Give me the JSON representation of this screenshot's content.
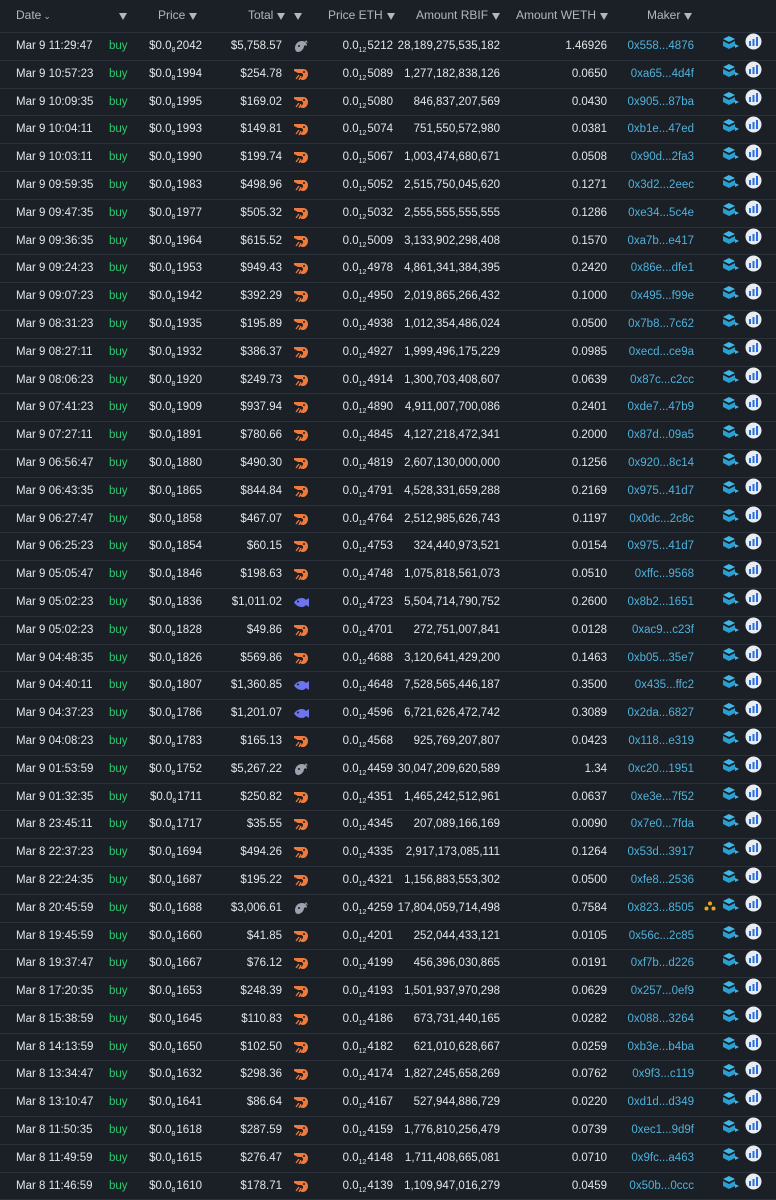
{
  "headers": {
    "date": "Date",
    "price": "Price",
    "total": "Total",
    "price_eth": "Price ETH",
    "amount_rbif": "Amount RBIF",
    "amount_weth": "Amount WETH",
    "maker": "Maker"
  },
  "colors": {
    "buy": "#2ec970",
    "maker": "#4fb2dc",
    "shrimp": "#f07a3c",
    "whale": "#9aa3ae",
    "fish": "#6c74ee"
  },
  "trades": [
    {
      "date": "Mar 9 11:29:47",
      "type": "buy",
      "price_pre": "$0.0",
      "price_sub": "8",
      "price_post": "2042",
      "total": "$5,758.57",
      "trader": "whale",
      "peth_pre": "0.0",
      "peth_sub": "12",
      "peth_post": "5212",
      "amount": "28,189,275,535,182",
      "weth": "1.46926",
      "maker": "0x558...4876"
    },
    {
      "date": "Mar 9 10:57:23",
      "type": "buy",
      "price_pre": "$0.0",
      "price_sub": "8",
      "price_post": "1994",
      "total": "$254.78",
      "trader": "shrimp",
      "peth_pre": "0.0",
      "peth_sub": "12",
      "peth_post": "5089",
      "amount": "1,277,182,838,126",
      "weth": "0.0650",
      "maker": "0xa65...4d4f"
    },
    {
      "date": "Mar 9 10:09:35",
      "type": "buy",
      "price_pre": "$0.0",
      "price_sub": "8",
      "price_post": "1995",
      "total": "$169.02",
      "trader": "shrimp",
      "peth_pre": "0.0",
      "peth_sub": "12",
      "peth_post": "5080",
      "amount": "846,837,207,569",
      "weth": "0.0430",
      "maker": "0x905...87ba"
    },
    {
      "date": "Mar 9 10:04:11",
      "type": "buy",
      "price_pre": "$0.0",
      "price_sub": "8",
      "price_post": "1993",
      "total": "$149.81",
      "trader": "shrimp",
      "peth_pre": "0.0",
      "peth_sub": "12",
      "peth_post": "5074",
      "amount": "751,550,572,980",
      "weth": "0.0381",
      "maker": "0xb1e...47ed"
    },
    {
      "date": "Mar 9 10:03:11",
      "type": "buy",
      "price_pre": "$0.0",
      "price_sub": "8",
      "price_post": "1990",
      "total": "$199.74",
      "trader": "shrimp",
      "peth_pre": "0.0",
      "peth_sub": "12",
      "peth_post": "5067",
      "amount": "1,003,474,680,671",
      "weth": "0.0508",
      "maker": "0x90d...2fa3"
    },
    {
      "date": "Mar 9 09:59:35",
      "type": "buy",
      "price_pre": "$0.0",
      "price_sub": "8",
      "price_post": "1983",
      "total": "$498.96",
      "trader": "shrimp",
      "peth_pre": "0.0",
      "peth_sub": "12",
      "peth_post": "5052",
      "amount": "2,515,750,045,620",
      "weth": "0.1271",
      "maker": "0x3d2...2eec"
    },
    {
      "date": "Mar 9 09:47:35",
      "type": "buy",
      "price_pre": "$0.0",
      "price_sub": "8",
      "price_post": "1977",
      "total": "$505.32",
      "trader": "shrimp",
      "peth_pre": "0.0",
      "peth_sub": "12",
      "peth_post": "5032",
      "amount": "2,555,555,555,555",
      "weth": "0.1286",
      "maker": "0xe34...5c4e"
    },
    {
      "date": "Mar 9 09:36:35",
      "type": "buy",
      "price_pre": "$0.0",
      "price_sub": "8",
      "price_post": "1964",
      "total": "$615.52",
      "trader": "shrimp",
      "peth_pre": "0.0",
      "peth_sub": "12",
      "peth_post": "5009",
      "amount": "3,133,902,298,408",
      "weth": "0.1570",
      "maker": "0xa7b...e417"
    },
    {
      "date": "Mar 9 09:24:23",
      "type": "buy",
      "price_pre": "$0.0",
      "price_sub": "8",
      "price_post": "1953",
      "total": "$949.43",
      "trader": "shrimp",
      "peth_pre": "0.0",
      "peth_sub": "12",
      "peth_post": "4978",
      "amount": "4,861,341,384,395",
      "weth": "0.2420",
      "maker": "0x86e...dfe1"
    },
    {
      "date": "Mar 9 09:07:23",
      "type": "buy",
      "price_pre": "$0.0",
      "price_sub": "8",
      "price_post": "1942",
      "total": "$392.29",
      "trader": "shrimp",
      "peth_pre": "0.0",
      "peth_sub": "12",
      "peth_post": "4950",
      "amount": "2,019,865,266,432",
      "weth": "0.1000",
      "maker": "0x495...f99e"
    },
    {
      "date": "Mar 9 08:31:23",
      "type": "buy",
      "price_pre": "$0.0",
      "price_sub": "8",
      "price_post": "1935",
      "total": "$195.89",
      "trader": "shrimp",
      "peth_pre": "0.0",
      "peth_sub": "12",
      "peth_post": "4938",
      "amount": "1,012,354,486,024",
      "weth": "0.0500",
      "maker": "0x7b8...7c62"
    },
    {
      "date": "Mar 9 08:27:11",
      "type": "buy",
      "price_pre": "$0.0",
      "price_sub": "8",
      "price_post": "1932",
      "total": "$386.37",
      "trader": "shrimp",
      "peth_pre": "0.0",
      "peth_sub": "12",
      "peth_post": "4927",
      "amount": "1,999,496,175,229",
      "weth": "0.0985",
      "maker": "0xecd...ce9a"
    },
    {
      "date": "Mar 9 08:06:23",
      "type": "buy",
      "price_pre": "$0.0",
      "price_sub": "8",
      "price_post": "1920",
      "total": "$249.73",
      "trader": "shrimp",
      "peth_pre": "0.0",
      "peth_sub": "12",
      "peth_post": "4914",
      "amount": "1,300,703,408,607",
      "weth": "0.0639",
      "maker": "0x87c...c2cc"
    },
    {
      "date": "Mar 9 07:41:23",
      "type": "buy",
      "price_pre": "$0.0",
      "price_sub": "8",
      "price_post": "1909",
      "total": "$937.94",
      "trader": "shrimp",
      "peth_pre": "0.0",
      "peth_sub": "12",
      "peth_post": "4890",
      "amount": "4,911,007,700,086",
      "weth": "0.2401",
      "maker": "0xde7...47b9"
    },
    {
      "date": "Mar 9 07:27:11",
      "type": "buy",
      "price_pre": "$0.0",
      "price_sub": "8",
      "price_post": "1891",
      "total": "$780.66",
      "trader": "shrimp",
      "peth_pre": "0.0",
      "peth_sub": "12",
      "peth_post": "4845",
      "amount": "4,127,218,472,341",
      "weth": "0.2000",
      "maker": "0x87d...09a5"
    },
    {
      "date": "Mar 9 06:56:47",
      "type": "buy",
      "price_pre": "$0.0",
      "price_sub": "8",
      "price_post": "1880",
      "total": "$490.30",
      "trader": "shrimp",
      "peth_pre": "0.0",
      "peth_sub": "12",
      "peth_post": "4819",
      "amount": "2,607,130,000,000",
      "weth": "0.1256",
      "maker": "0x920...8c14"
    },
    {
      "date": "Mar 9 06:43:35",
      "type": "buy",
      "price_pre": "$0.0",
      "price_sub": "8",
      "price_post": "1865",
      "total": "$844.84",
      "trader": "shrimp",
      "peth_pre": "0.0",
      "peth_sub": "12",
      "peth_post": "4791",
      "amount": "4,528,331,659,288",
      "weth": "0.2169",
      "maker": "0x975...41d7"
    },
    {
      "date": "Mar 9 06:27:47",
      "type": "buy",
      "price_pre": "$0.0",
      "price_sub": "8",
      "price_post": "1858",
      "total": "$467.07",
      "trader": "shrimp",
      "peth_pre": "0.0",
      "peth_sub": "12",
      "peth_post": "4764",
      "amount": "2,512,985,626,743",
      "weth": "0.1197",
      "maker": "0x0dc...2c8c"
    },
    {
      "date": "Mar 9 06:25:23",
      "type": "buy",
      "price_pre": "$0.0",
      "price_sub": "8",
      "price_post": "1854",
      "total": "$60.15",
      "trader": "shrimp",
      "peth_pre": "0.0",
      "peth_sub": "12",
      "peth_post": "4753",
      "amount": "324,440,973,521",
      "weth": "0.0154",
      "maker": "0x975...41d7"
    },
    {
      "date": "Mar 9 05:05:47",
      "type": "buy",
      "price_pre": "$0.0",
      "price_sub": "8",
      "price_post": "1846",
      "total": "$198.63",
      "trader": "shrimp",
      "peth_pre": "0.0",
      "peth_sub": "12",
      "peth_post": "4748",
      "amount": "1,075,818,561,073",
      "weth": "0.0510",
      "maker": "0xffc...9568"
    },
    {
      "date": "Mar 9 05:02:23",
      "type": "buy",
      "price_pre": "$0.0",
      "price_sub": "8",
      "price_post": "1836",
      "total": "$1,011.02",
      "trader": "fish",
      "peth_pre": "0.0",
      "peth_sub": "12",
      "peth_post": "4723",
      "amount": "5,504,714,790,752",
      "weth": "0.2600",
      "maker": "0x8b2...1651"
    },
    {
      "date": "Mar 9 05:02:23",
      "type": "buy",
      "price_pre": "$0.0",
      "price_sub": "8",
      "price_post": "1828",
      "total": "$49.86",
      "trader": "shrimp",
      "peth_pre": "0.0",
      "peth_sub": "12",
      "peth_post": "4701",
      "amount": "272,751,007,841",
      "weth": "0.0128",
      "maker": "0xac9...c23f"
    },
    {
      "date": "Mar 9 04:48:35",
      "type": "buy",
      "price_pre": "$0.0",
      "price_sub": "8",
      "price_post": "1826",
      "total": "$569.86",
      "trader": "shrimp",
      "peth_pre": "0.0",
      "peth_sub": "12",
      "peth_post": "4688",
      "amount": "3,120,641,429,200",
      "weth": "0.1463",
      "maker": "0xb05...35e7"
    },
    {
      "date": "Mar 9 04:40:11",
      "type": "buy",
      "price_pre": "$0.0",
      "price_sub": "8",
      "price_post": "1807",
      "total": "$1,360.85",
      "trader": "fish",
      "peth_pre": "0.0",
      "peth_sub": "12",
      "peth_post": "4648",
      "amount": "7,528,565,446,187",
      "weth": "0.3500",
      "maker": "0x435...ffc2"
    },
    {
      "date": "Mar 9 04:37:23",
      "type": "buy",
      "price_pre": "$0.0",
      "price_sub": "8",
      "price_post": "1786",
      "total": "$1,201.07",
      "trader": "fish",
      "peth_pre": "0.0",
      "peth_sub": "12",
      "peth_post": "4596",
      "amount": "6,721,626,472,742",
      "weth": "0.3089",
      "maker": "0x2da...6827"
    },
    {
      "date": "Mar 9 04:08:23",
      "type": "buy",
      "price_pre": "$0.0",
      "price_sub": "8",
      "price_post": "1783",
      "total": "$165.13",
      "trader": "shrimp",
      "peth_pre": "0.0",
      "peth_sub": "12",
      "peth_post": "4568",
      "amount": "925,769,207,807",
      "weth": "0.0423",
      "maker": "0x118...e319"
    },
    {
      "date": "Mar 9 01:53:59",
      "type": "buy",
      "price_pre": "$0.0",
      "price_sub": "8",
      "price_post": "1752",
      "total": "$5,267.22",
      "trader": "whale",
      "peth_pre": "0.0",
      "peth_sub": "12",
      "peth_post": "4459",
      "amount": "30,047,209,620,589",
      "weth": "1.34",
      "maker": "0xc20...1951"
    },
    {
      "date": "Mar 9 01:32:35",
      "type": "buy",
      "price_pre": "$0.0",
      "price_sub": "8",
      "price_post": "1711",
      "total": "$250.82",
      "trader": "shrimp",
      "peth_pre": "0.0",
      "peth_sub": "12",
      "peth_post": "4351",
      "amount": "1,465,242,512,961",
      "weth": "0.0637",
      "maker": "0xe3e...7f52"
    },
    {
      "date": "Mar 8 23:45:11",
      "type": "buy",
      "price_pre": "$0.0",
      "price_sub": "8",
      "price_post": "1717",
      "total": "$35.55",
      "trader": "shrimp",
      "peth_pre": "0.0",
      "peth_sub": "12",
      "peth_post": "4345",
      "amount": "207,089,166,169",
      "weth": "0.0090",
      "maker": "0x7e0...7fda"
    },
    {
      "date": "Mar 8 22:37:23",
      "type": "buy",
      "price_pre": "$0.0",
      "price_sub": "8",
      "price_post": "1694",
      "total": "$494.26",
      "trader": "shrimp",
      "peth_pre": "0.0",
      "peth_sub": "12",
      "peth_post": "4335",
      "amount": "2,917,173,085,111",
      "weth": "0.1264",
      "maker": "0x53d...3917"
    },
    {
      "date": "Mar 8 22:24:35",
      "type": "buy",
      "price_pre": "$0.0",
      "price_sub": "8",
      "price_post": "1687",
      "total": "$195.22",
      "trader": "shrimp",
      "peth_pre": "0.0",
      "peth_sub": "12",
      "peth_post": "4321",
      "amount": "1,156,883,553,302",
      "weth": "0.0500",
      "maker": "0xfe8...2536"
    },
    {
      "date": "Mar 8 20:45:59",
      "type": "buy",
      "price_pre": "$0.0",
      "price_sub": "8",
      "price_post": "1688",
      "total": "$3,006.61",
      "trader": "whale",
      "peth_pre": "0.0",
      "peth_sub": "12",
      "peth_post": "4259",
      "amount": "17,804,059,714,498",
      "weth": "0.7584",
      "maker": "0x823...8505",
      "sweep": true
    },
    {
      "date": "Mar 8 19:45:59",
      "type": "buy",
      "price_pre": "$0.0",
      "price_sub": "8",
      "price_post": "1660",
      "total": "$41.85",
      "trader": "shrimp",
      "peth_pre": "0.0",
      "peth_sub": "12",
      "peth_post": "4201",
      "amount": "252,044,433,121",
      "weth": "0.0105",
      "maker": "0x56c...2c85"
    },
    {
      "date": "Mar 8 19:37:47",
      "type": "buy",
      "price_pre": "$0.0",
      "price_sub": "8",
      "price_post": "1667",
      "total": "$76.12",
      "trader": "shrimp",
      "peth_pre": "0.0",
      "peth_sub": "12",
      "peth_post": "4199",
      "amount": "456,396,030,865",
      "weth": "0.0191",
      "maker": "0xf7b...d226"
    },
    {
      "date": "Mar 8 17:20:35",
      "type": "buy",
      "price_pre": "$0.0",
      "price_sub": "8",
      "price_post": "1653",
      "total": "$248.39",
      "trader": "shrimp",
      "peth_pre": "0.0",
      "peth_sub": "12",
      "peth_post": "4193",
      "amount": "1,501,937,970,298",
      "weth": "0.0629",
      "maker": "0x257...0ef9"
    },
    {
      "date": "Mar 8 15:38:59",
      "type": "buy",
      "price_pre": "$0.0",
      "price_sub": "8",
      "price_post": "1645",
      "total": "$110.83",
      "trader": "shrimp",
      "peth_pre": "0.0",
      "peth_sub": "12",
      "peth_post": "4186",
      "amount": "673,731,440,165",
      "weth": "0.0282",
      "maker": "0x088...3264"
    },
    {
      "date": "Mar 8 14:13:59",
      "type": "buy",
      "price_pre": "$0.0",
      "price_sub": "8",
      "price_post": "1650",
      "total": "$102.50",
      "trader": "shrimp",
      "peth_pre": "0.0",
      "peth_sub": "12",
      "peth_post": "4182",
      "amount": "621,010,628,667",
      "weth": "0.0259",
      "maker": "0xb3e...b4ba"
    },
    {
      "date": "Mar 8 13:34:47",
      "type": "buy",
      "price_pre": "$0.0",
      "price_sub": "8",
      "price_post": "1632",
      "total": "$298.36",
      "trader": "shrimp",
      "peth_pre": "0.0",
      "peth_sub": "12",
      "peth_post": "4174",
      "amount": "1,827,245,658,269",
      "weth": "0.0762",
      "maker": "0x9f3...c119"
    },
    {
      "date": "Mar 8 13:10:47",
      "type": "buy",
      "price_pre": "$0.0",
      "price_sub": "8",
      "price_post": "1641",
      "total": "$86.64",
      "trader": "shrimp",
      "peth_pre": "0.0",
      "peth_sub": "12",
      "peth_post": "4167",
      "amount": "527,944,886,729",
      "weth": "0.0220",
      "maker": "0xd1d...d349"
    },
    {
      "date": "Mar 8 11:50:35",
      "type": "buy",
      "price_pre": "$0.0",
      "price_sub": "8",
      "price_post": "1618",
      "total": "$287.59",
      "trader": "shrimp",
      "peth_pre": "0.0",
      "peth_sub": "12",
      "peth_post": "4159",
      "amount": "1,776,810,256,479",
      "weth": "0.0739",
      "maker": "0xec1...9d9f"
    },
    {
      "date": "Mar 8 11:49:59",
      "type": "buy",
      "price_pre": "$0.0",
      "price_sub": "8",
      "price_post": "1615",
      "total": "$276.47",
      "trader": "shrimp",
      "peth_pre": "0.0",
      "peth_sub": "12",
      "peth_post": "4148",
      "amount": "1,711,408,665,081",
      "weth": "0.0710",
      "maker": "0x9fc...a463"
    },
    {
      "date": "Mar 8 11:46:59",
      "type": "buy",
      "price_pre": "$0.0",
      "price_sub": "8",
      "price_post": "1610",
      "total": "$178.71",
      "trader": "shrimp",
      "peth_pre": "0.0",
      "peth_sub": "12",
      "peth_post": "4139",
      "amount": "1,109,947,016,279",
      "weth": "0.0459",
      "maker": "0x50b...0ccc"
    }
  ]
}
